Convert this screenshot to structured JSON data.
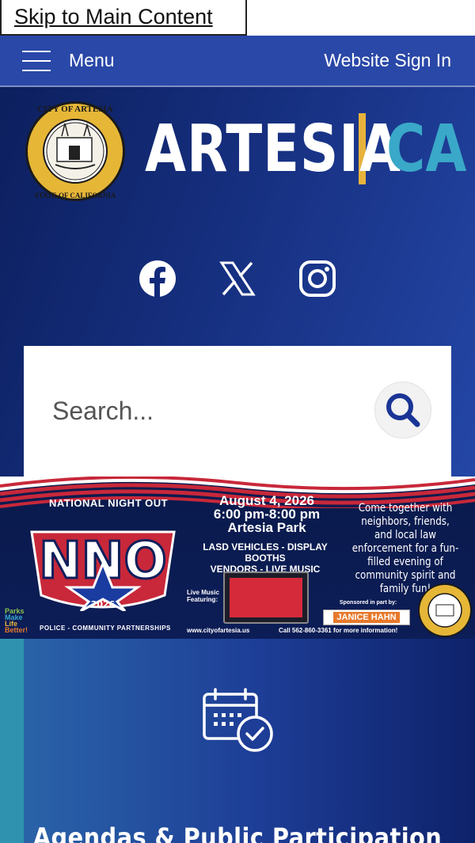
{
  "skip_link": {
    "label": "Skip to Main Content"
  },
  "topbar": {
    "menu_label": "Menu",
    "signin_label": "Website Sign In",
    "bg_color": "#2a48a8"
  },
  "header": {
    "wordmark_left": "ARTESIA",
    "wordmark_right": "CA",
    "seal_text_top": "CITY OF ARTESIA",
    "seal_text_bottom": "STATE OF CALIFORNIA",
    "seal_incorporated": "INCORPORATED 1959",
    "accent_gold": "#e8b33c",
    "accent_teal": "#3aa8c8"
  },
  "socials": [
    {
      "name": "facebook-icon"
    },
    {
      "name": "x-icon"
    },
    {
      "name": "instagram-icon"
    }
  ],
  "search": {
    "placeholder": "Search..."
  },
  "banner": {
    "nno_heading": "NATIONAL NIGHT OUT",
    "nno_letters": "NNO",
    "nno_year": "2026",
    "partnership": "POLICE - COMMUNITY PARTNERSHIPS",
    "parks_lines": [
      "Parks",
      "Make",
      "Life",
      "Better!"
    ],
    "date": "August 4, 2026",
    "time": "6:00 pm-8:00 pm",
    "location": "Artesia Park",
    "features_line1": "LASD VEHICLES - DISPLAY BOOTHS",
    "features_line2": "VENDORS - LIVE MUSIC",
    "pitch": "Come together with neighbors, friends, and local law enforcement for a fun-filled evening of community spirit and family fun!",
    "live_music": "Live Music Featuring:",
    "sponsored": "Sponsored in part by:",
    "sponsor_name": "JANICE HAHN",
    "url": "www.cityofartesia.us",
    "call": "Call 562-860-3361 for more information!"
  },
  "agenda": {
    "title": "Agendas & Public Participation"
  }
}
